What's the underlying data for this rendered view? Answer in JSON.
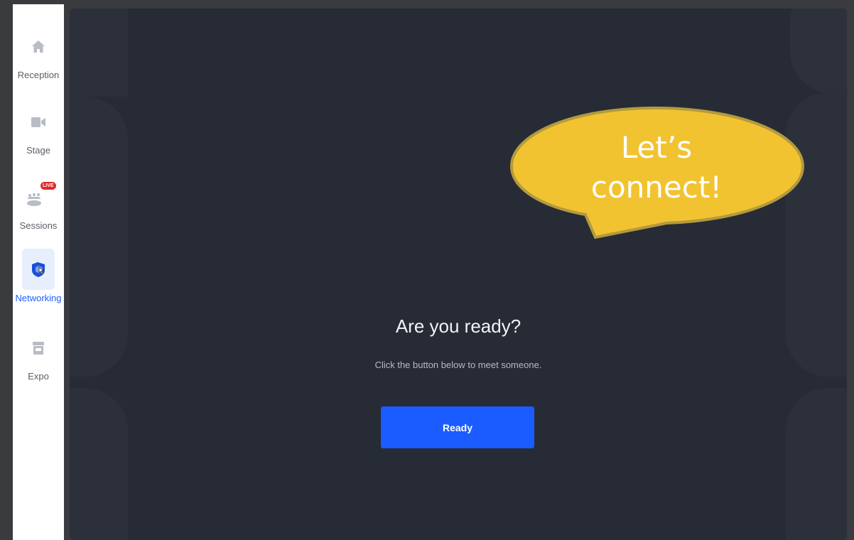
{
  "sidebar": {
    "items": [
      {
        "label": "Reception",
        "icon": "home-icon",
        "active": false
      },
      {
        "label": "Stage",
        "icon": "video-camera-icon",
        "active": false
      },
      {
        "label": "Sessions",
        "icon": "audience-icon",
        "badge": "LIVE",
        "active": false
      },
      {
        "label": "Networking",
        "icon": "networking-hand-icon",
        "active": true
      },
      {
        "label": "Expo",
        "icon": "booth-icon",
        "active": false
      }
    ]
  },
  "main": {
    "title": "Are you ready?",
    "subtitle": "Click the button below to meet someone.",
    "ready_label": "Ready"
  },
  "callout": {
    "line1": "Let’s",
    "line2": "connect!"
  },
  "colors": {
    "accent": "#1a5cff",
    "panel_bg": "#262b35",
    "bubble_fill": "#f2c331",
    "bubble_stroke": "#b39a3e",
    "live_badge": "#e0282e"
  }
}
